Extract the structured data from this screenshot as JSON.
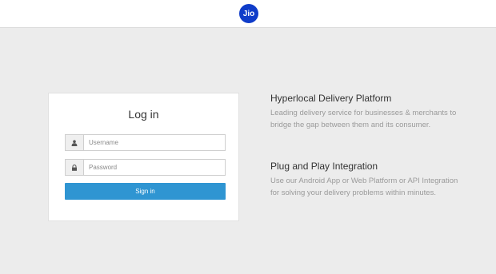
{
  "header": {
    "logo_text": "Jio"
  },
  "login": {
    "title": "Log in",
    "username_placeholder": "Username",
    "password_placeholder": "Password",
    "signin_label": "Sign in"
  },
  "features": [
    {
      "title": "Hyperlocal Delivery Platform",
      "description": "Leading delivery service for businesses & merchants to bridge the gap between them and its consumer."
    },
    {
      "title": "Plug and Play Integration",
      "description": "Use our Android App or Web Platform or API Integration for solving your delivery problems within minutes."
    }
  ],
  "colors": {
    "logo": "#0f3cc9",
    "button": "#2f95d2",
    "background": "#ececec"
  }
}
